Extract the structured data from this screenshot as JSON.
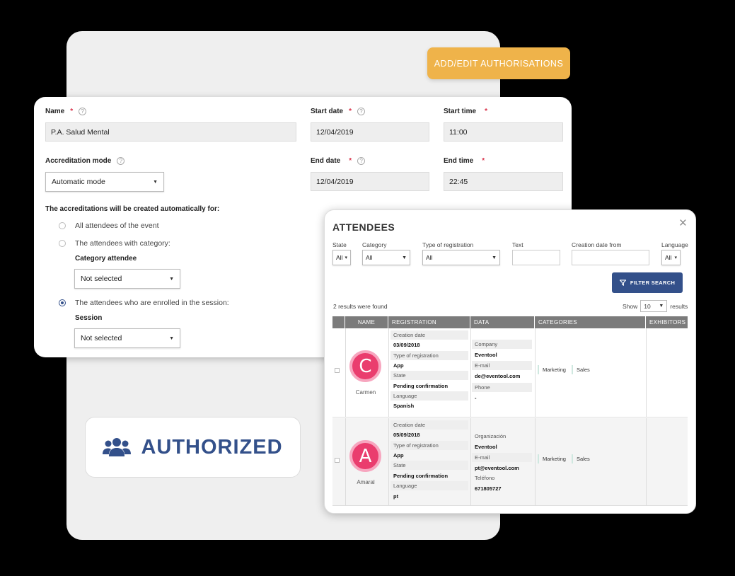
{
  "auth_button_label": "ADD/EDIT AUTHORISATIONS",
  "form": {
    "name_label": "Name",
    "name_value": "P.A. Salud Mental",
    "start_date_label": "Start date",
    "start_date_value": "12/04/2019",
    "start_time_label": "Start time",
    "start_time_value": "11:00",
    "accreditation_mode_label": "Accreditation mode",
    "accreditation_mode_value": "Automatic mode",
    "end_date_label": "End date",
    "end_date_value": "12/04/2019",
    "end_time_label": "End time",
    "end_time_value": "22:45",
    "auto_label": "The accreditations will be created automatically for:",
    "option_all": "All attendees of the event",
    "option_category": "The attendees with category:",
    "category_label": "Category attendee",
    "category_value": "Not selected",
    "option_session": "The attendees who are enrolled in the session:",
    "session_label": "Session",
    "session_value": "Not selected",
    "required_mark": "*",
    "help_glyph": "?"
  },
  "authorized": {
    "label": "AUTHORIZED",
    "icon": "users-icon",
    "color": "#33508a"
  },
  "attendees": {
    "title": "ATTENDEES",
    "close_glyph": "×",
    "filters": {
      "state_label": "State",
      "state_value": "All",
      "category_label": "Category",
      "category_value": "All",
      "type_label": "Type of registration",
      "type_value": "All",
      "text_label": "Text",
      "creation_label": "Creation date from",
      "language_label": "Language",
      "language_value": "All"
    },
    "filter_button": "FILTER SEARCH",
    "results_text": "2 results were found",
    "show_label": "Show",
    "show_value": "10",
    "results_label": "results",
    "columns": [
      "NAME",
      "REGISTRATION",
      "DATA",
      "CATEGORIES",
      "EXHIBITORS"
    ],
    "rows": [
      {
        "initial": "C",
        "name": "Carmen",
        "registration": {
          "creation_label": "Creation date",
          "creation_value": "03/09/2018",
          "type_label": "Type of registration",
          "type_value": "App",
          "state_label": "State",
          "state_value": "Pending confirmation",
          "language_label": "Language",
          "language_value": "Spanish"
        },
        "data": {
          "company_label": "Company",
          "company_value": "Eventool",
          "email_label": "E-mail",
          "email_value": "de@eventool.com",
          "phone_label": "Phone",
          "phone_value": "-"
        },
        "categories": [
          "Marketing",
          "Sales"
        ]
      },
      {
        "initial": "A",
        "name": "Amaral",
        "registration": {
          "creation_label": "Creation date",
          "creation_value": "05/09/2018",
          "type_label": "Type of registration",
          "type_value": "App",
          "state_label": "State",
          "state_value": "Pending confirmation",
          "language_label": "Language",
          "language_value": "pt"
        },
        "data": {
          "company_label": "Organización",
          "company_value": "Eventool",
          "email_label": "E-mail",
          "email_value": "pt@eventool.com",
          "phone_label": "Teléfono",
          "phone_value": "671805727"
        },
        "categories": [
          "Marketing",
          "Sales"
        ]
      }
    ]
  },
  "colors": {
    "accent_orange": "#efb34a",
    "primary_blue": "#33508a",
    "required_red": "#d8324a",
    "avatar_pink": "#ea3d6e"
  }
}
